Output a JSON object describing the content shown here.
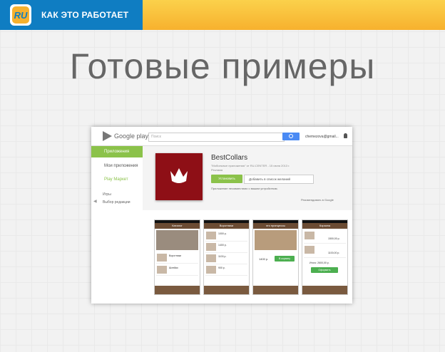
{
  "header": {
    "logo_text": "RU",
    "section_title": "КАК ЭТО РАБОТАЕТ"
  },
  "headline": "Готовые примеры",
  "screenshot": {
    "google_play": {
      "logo": "Google play",
      "search_placeholder": "Поиск",
      "user": "chemezova@gmail...",
      "sidebar": {
        "apps_label": "Приложения",
        "my_apps": "Мои приложения",
        "market": "Play Маркет",
        "games": "Игры",
        "editors": "Выбор редакции"
      },
      "app": {
        "title": "BestCollars",
        "meta": "\"Мобильные приложения\" от RU-CENTER - 15 июля 2013 г.",
        "category": "Реклама",
        "install": "Установить",
        "wishlist": "Добавить в список желаний",
        "compat": "Приложение несовместимо с вашим устройством.",
        "recommend": "Рекомендовать в Google"
      }
    },
    "phones": [
      {
        "title": "Каталог",
        "rows": [
          "Воротники",
          "Шлейки"
        ]
      },
      {
        "title": "Воротники",
        "rows": [
          "1000 р.",
          "1400 р.",
          "1100 р.",
          "900 р."
        ]
      },
      {
        "title": "это принцессы",
        "rows": [
          "1400 р.",
          "В корзину"
        ]
      },
      {
        "title": "Корзина",
        "rows": [
          "1500,00 р.",
          "1100,00 р.",
          "Итого: 2600,00 р.",
          "Оформить"
        ]
      }
    ]
  }
}
